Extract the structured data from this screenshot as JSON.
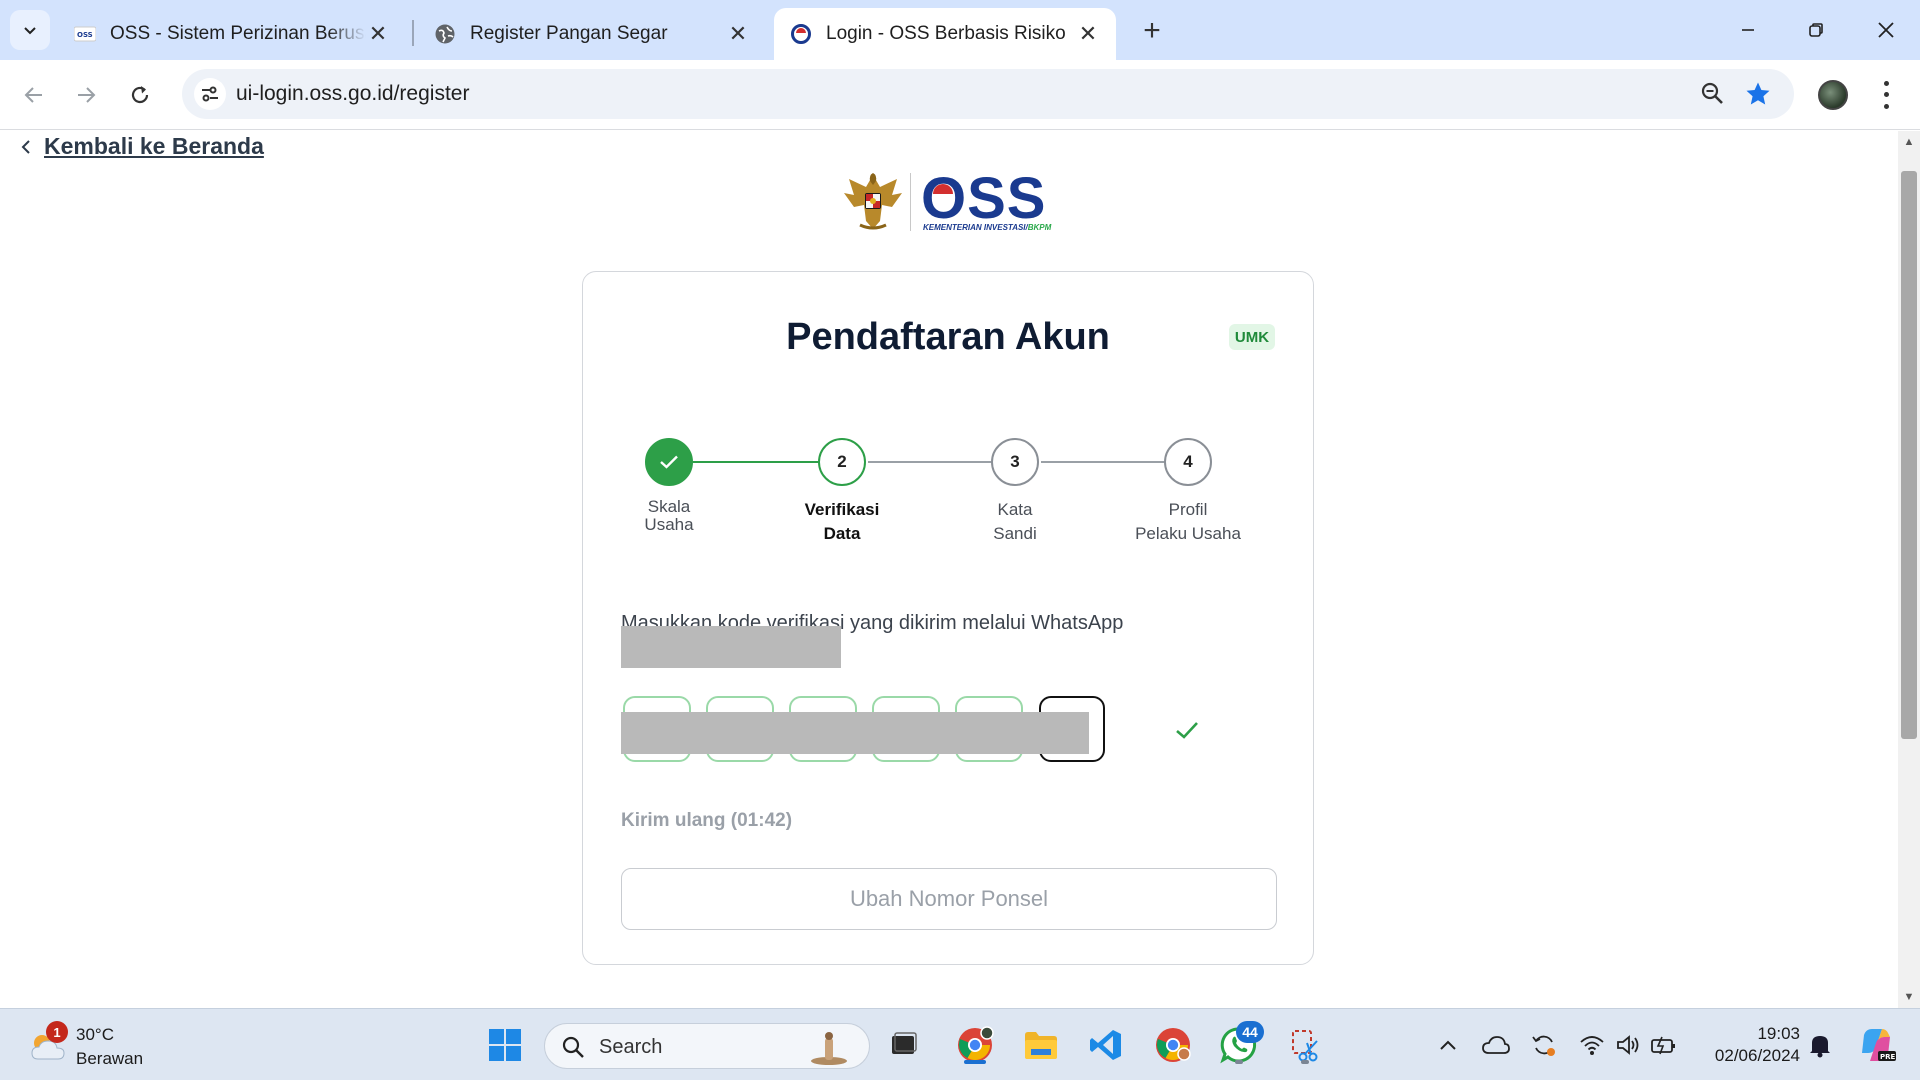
{
  "browser": {
    "tabs": [
      {
        "title": "OSS - Sistem Perizinan Berusaha",
        "favicon": "oss-favicon",
        "active": false
      },
      {
        "title": "Register Pangan Segar",
        "favicon": "globe-icon",
        "active": false
      },
      {
        "title": "Login - OSS Berbasis Risiko",
        "favicon": "oss-ring-favicon",
        "active": true
      }
    ],
    "url": "ui-login.oss.go.id/register",
    "accent_color": "#1a73e8"
  },
  "page": {
    "back_label": "Kembali ke Beranda",
    "logo": {
      "word": "OSS",
      "subtitle_main": "KEMENTERIAN INVESTASI/",
      "subtitle_green": "BKPM"
    },
    "card": {
      "title": "Pendaftaran Akun",
      "badge": "UMK",
      "steps": [
        {
          "number": "",
          "label_line1": "Skala",
          "label_line2": "Usaha",
          "state": "done"
        },
        {
          "number": "2",
          "label_line1": "Verifikasi",
          "label_line2": "Data",
          "state": "current"
        },
        {
          "number": "3",
          "label_line1": "Kata",
          "label_line2": "Sandi",
          "state": "upcoming"
        },
        {
          "number": "4",
          "label_line1": "Profil",
          "label_line2": "Pelaku Usaha",
          "state": "upcoming"
        }
      ],
      "verify_instruction": "Masukkan kode verifikasi yang dikirim melalui WhatsApp",
      "otp_boxes": 6,
      "resend_label": "Kirim ulang (01:42)",
      "change_phone_label": "Ubah Nomor Ponsel"
    },
    "colors": {
      "success": "#2d9f48",
      "title": "#0f1c33",
      "muted": "#9aa0a8"
    }
  },
  "taskbar": {
    "weather": {
      "temp": "30°C",
      "condition": "Berawan",
      "badge": "1"
    },
    "search_placeholder": "Search",
    "whatsapp_badge": "44",
    "time": "19:03",
    "date": "02/06/2024"
  }
}
